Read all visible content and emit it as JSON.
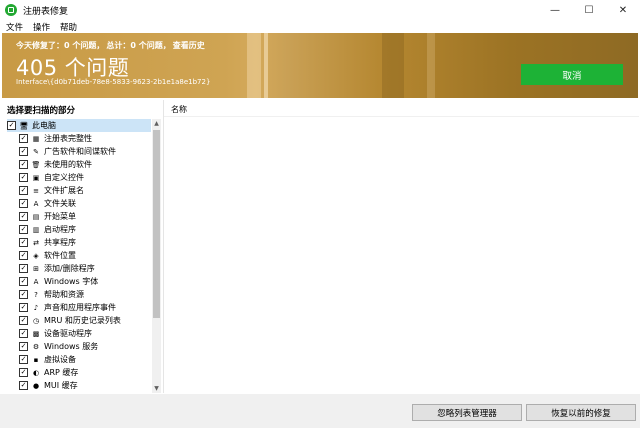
{
  "window": {
    "title": "注册表修复",
    "minimize": "—",
    "maximize": "☐",
    "close": "✕"
  },
  "menu": [
    "文件",
    "操作",
    "帮助"
  ],
  "banner": {
    "today_fixed": "今天修复了：0 个问题，",
    "total": "总计：0 个问题，",
    "history_link": "查看历史",
    "issue_count": "405 个问题",
    "interface_id": "Interface\\{d0b71deb-78e8-5833-9623-2b1e1a8e1b72}",
    "cancel_label": "取消"
  },
  "left_panel": {
    "header": "选择要扫描的部分",
    "items": [
      {
        "label": "此电脑",
        "checked": true,
        "icon": "computer-icon",
        "glyph": "🖥",
        "root": true
      },
      {
        "label": "注册表完整性",
        "checked": true,
        "icon": "registry-icon",
        "glyph": "▦"
      },
      {
        "label": "广告软件和间谍软件",
        "checked": true,
        "icon": "adware-icon",
        "glyph": "✎"
      },
      {
        "label": "未使用的软件",
        "checked": true,
        "icon": "trash-icon",
        "glyph": "🗑"
      },
      {
        "label": "自定义控件",
        "checked": true,
        "icon": "controls-icon",
        "glyph": "▣"
      },
      {
        "label": "文件扩展名",
        "checked": true,
        "icon": "file-ext-icon",
        "glyph": "≡"
      },
      {
        "label": "文件关联",
        "checked": true,
        "icon": "file-assoc-icon",
        "glyph": "A"
      },
      {
        "label": "开始菜单",
        "checked": true,
        "icon": "start-menu-icon",
        "glyph": "▤"
      },
      {
        "label": "启动程序",
        "checked": true,
        "icon": "startup-icon",
        "glyph": "▥"
      },
      {
        "label": "共享程序",
        "checked": true,
        "icon": "shared-icon",
        "glyph": "⇄"
      },
      {
        "label": "软件位置",
        "checked": true,
        "icon": "software-location-icon",
        "glyph": "◈"
      },
      {
        "label": "添加/删除程序",
        "checked": true,
        "icon": "add-remove-icon",
        "glyph": "⊞"
      },
      {
        "label": "Windows 字体",
        "checked": true,
        "icon": "font-icon",
        "glyph": "A"
      },
      {
        "label": "帮助和资源",
        "checked": true,
        "icon": "help-icon",
        "glyph": "?"
      },
      {
        "label": "声音和应用程序事件",
        "checked": true,
        "icon": "sound-icon",
        "glyph": "♪"
      },
      {
        "label": "MRU 和历史记录列表",
        "checked": true,
        "icon": "history-icon",
        "glyph": "◷"
      },
      {
        "label": "设备驱动程序",
        "checked": true,
        "icon": "driver-icon",
        "glyph": "▩"
      },
      {
        "label": "Windows 服务",
        "checked": true,
        "icon": "services-icon",
        "glyph": "⚙"
      },
      {
        "label": "虚拟设备",
        "checked": true,
        "icon": "virtual-device-icon",
        "glyph": "▪"
      },
      {
        "label": "ARP 缓存",
        "checked": true,
        "icon": "arp-icon",
        "glyph": "◐"
      },
      {
        "label": "MUI 缓存",
        "checked": true,
        "icon": "mui-icon",
        "glyph": "●"
      }
    ]
  },
  "right_panel": {
    "column_header": "名称"
  },
  "footer": {
    "ignore_list_label": "忽略列表管理器",
    "restore_label": "恢复以前的修复"
  },
  "colors": {
    "banner_gold": "#c89a45",
    "cancel_green": "#1db236",
    "app_green": "#22a832",
    "selection": "#cce4f7"
  }
}
